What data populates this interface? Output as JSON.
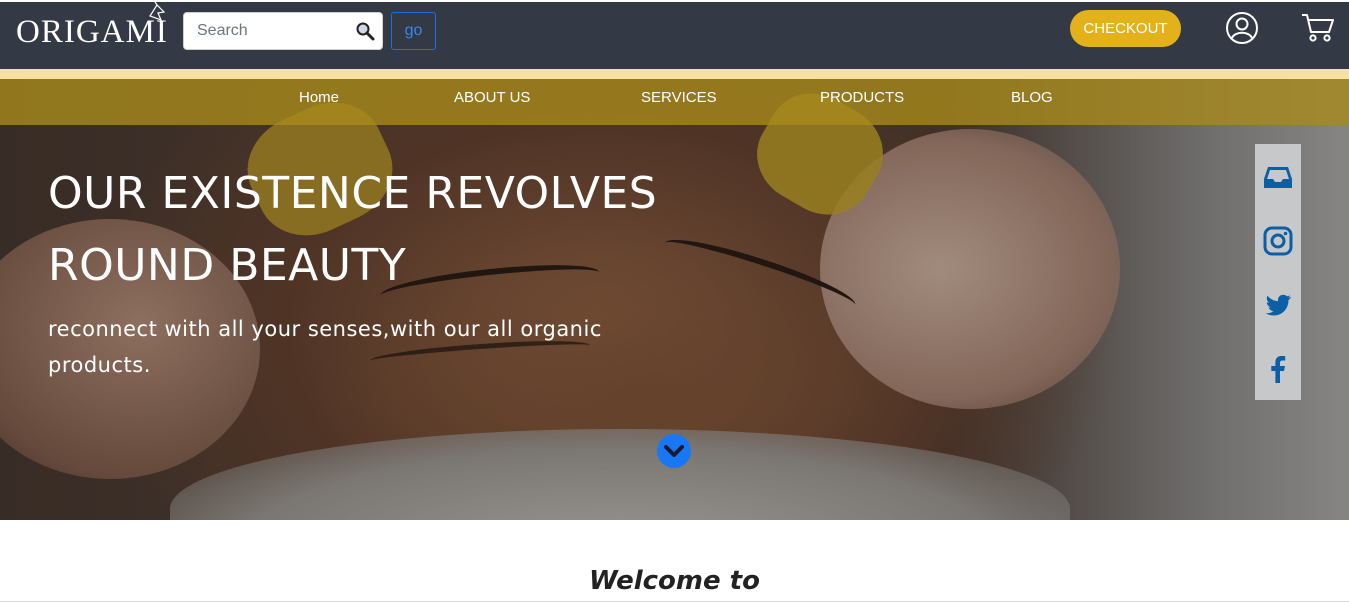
{
  "header": {
    "logo_text": "ORIGAMI",
    "search": {
      "placeholder": "Search",
      "value": ""
    },
    "go_label": "go",
    "checkout_label": "CHECKOUT",
    "icons": [
      "search-icon",
      "user-icon",
      "cart-icon"
    ]
  },
  "nav": {
    "items": [
      {
        "label": "Home"
      },
      {
        "label": "ABOUT US"
      },
      {
        "label": "SERVICES"
      },
      {
        "label": "PRODUCTS"
      },
      {
        "label": "BLOG"
      }
    ]
  },
  "hero": {
    "title": "OUR EXISTENCE REVOLVES ROUND BEAUTY",
    "subtitle": "reconnect with all your senses,with our all organic products.",
    "scroll_icon": "chevron-down-circle-icon"
  },
  "social": {
    "icons": [
      "inbox-icon",
      "instagram-icon",
      "twitter-icon",
      "facebook-icon"
    ]
  },
  "welcome": {
    "heading": "Welcome to"
  },
  "colors": {
    "header_bg": "#343a45",
    "accent_gold": "#e3b119",
    "nav_bg": "#a88a1c",
    "nav_accent": "#f5e2a0",
    "social_blue": "#0b5fa5",
    "scroll_blue": "#1877f2",
    "social_rail_bg": "#c7c8c9"
  }
}
